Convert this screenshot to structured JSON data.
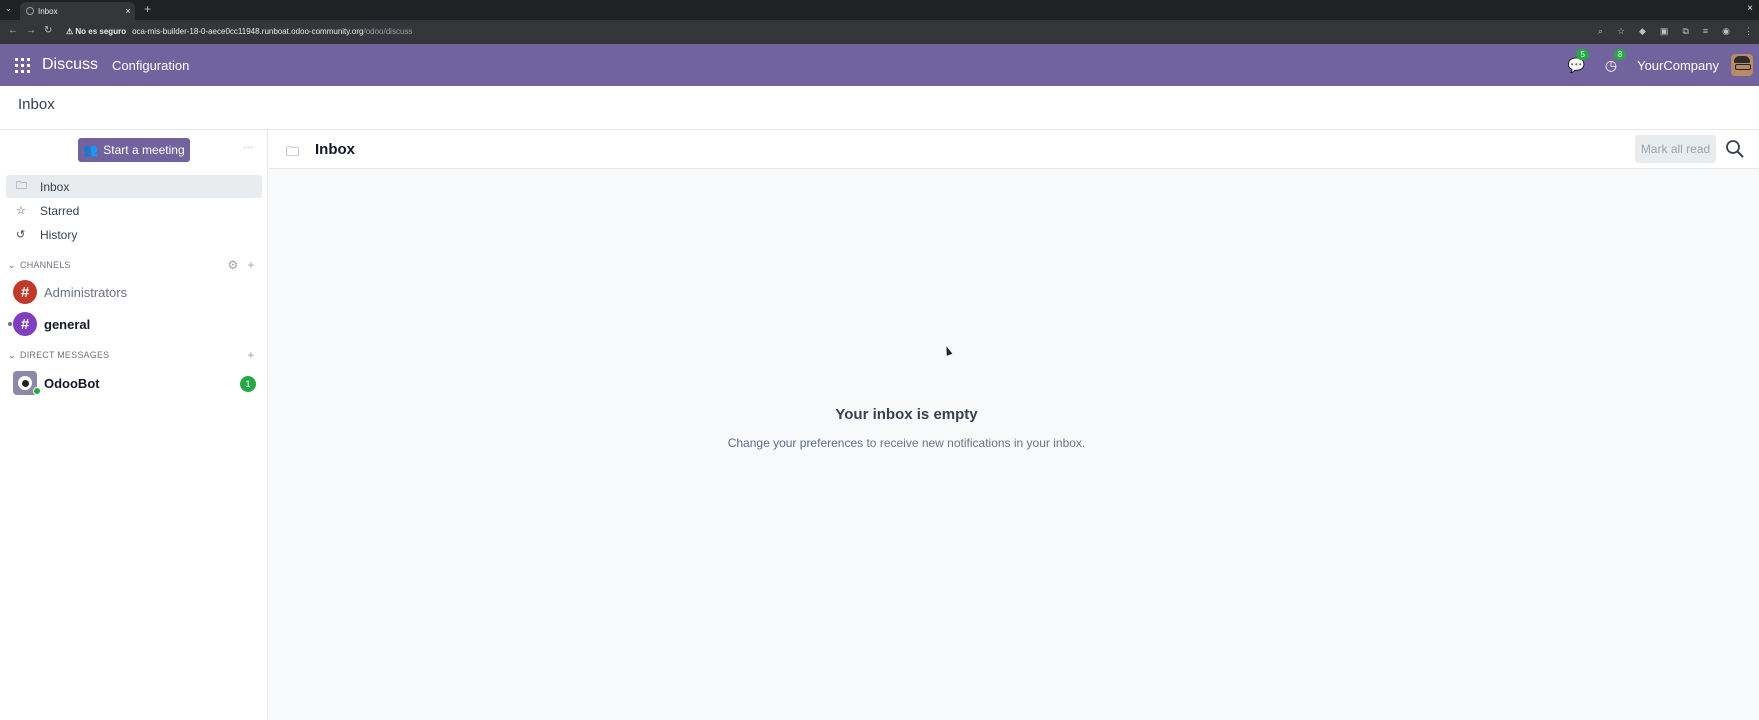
{
  "browser": {
    "tab_title": "Inbox",
    "tab_close": "×",
    "new_tab": "+",
    "window_close": "×",
    "security_label": "⚠ No es seguro",
    "url_host": "oca-mis-builder-18-0-aece0cc11948.runboat.odoo-community.org",
    "url_path": "/odoo/discuss"
  },
  "navbar": {
    "app_name": "Discuss",
    "menu_configuration": "Configuration",
    "messages_count": "5",
    "activities_count": "8",
    "company": "YourCompany"
  },
  "control_panel": {
    "title": "Inbox"
  },
  "sidebar": {
    "start_meeting_label": "Start a meeting",
    "more_label": "···",
    "mailboxes": [
      {
        "label": "Inbox",
        "icon": "inbox-icon",
        "glyph": "🗀"
      },
      {
        "label": "Starred",
        "icon": "star-icon",
        "glyph": "☆"
      },
      {
        "label": "History",
        "icon": "history-icon",
        "glyph": "↺"
      }
    ],
    "channels_header": "CHANNELS",
    "channels": [
      {
        "name": "Administrators",
        "color": "#c0392b",
        "unread": false
      },
      {
        "name": "general",
        "color": "#7f3fbf",
        "unread": true
      }
    ],
    "dm_header": "DIRECT MESSAGES",
    "direct_messages": [
      {
        "name": "OdooBot",
        "badge": "1",
        "online": true
      }
    ]
  },
  "thread": {
    "title": "Inbox",
    "mark_all_read": "Mark all read",
    "empty_title": "Your inbox is empty",
    "empty_link": "Change your preferences",
    "empty_rest": " to receive new notifications in your inbox."
  },
  "colors": {
    "brand": "#71639e",
    "badge_green": "#28a745"
  }
}
